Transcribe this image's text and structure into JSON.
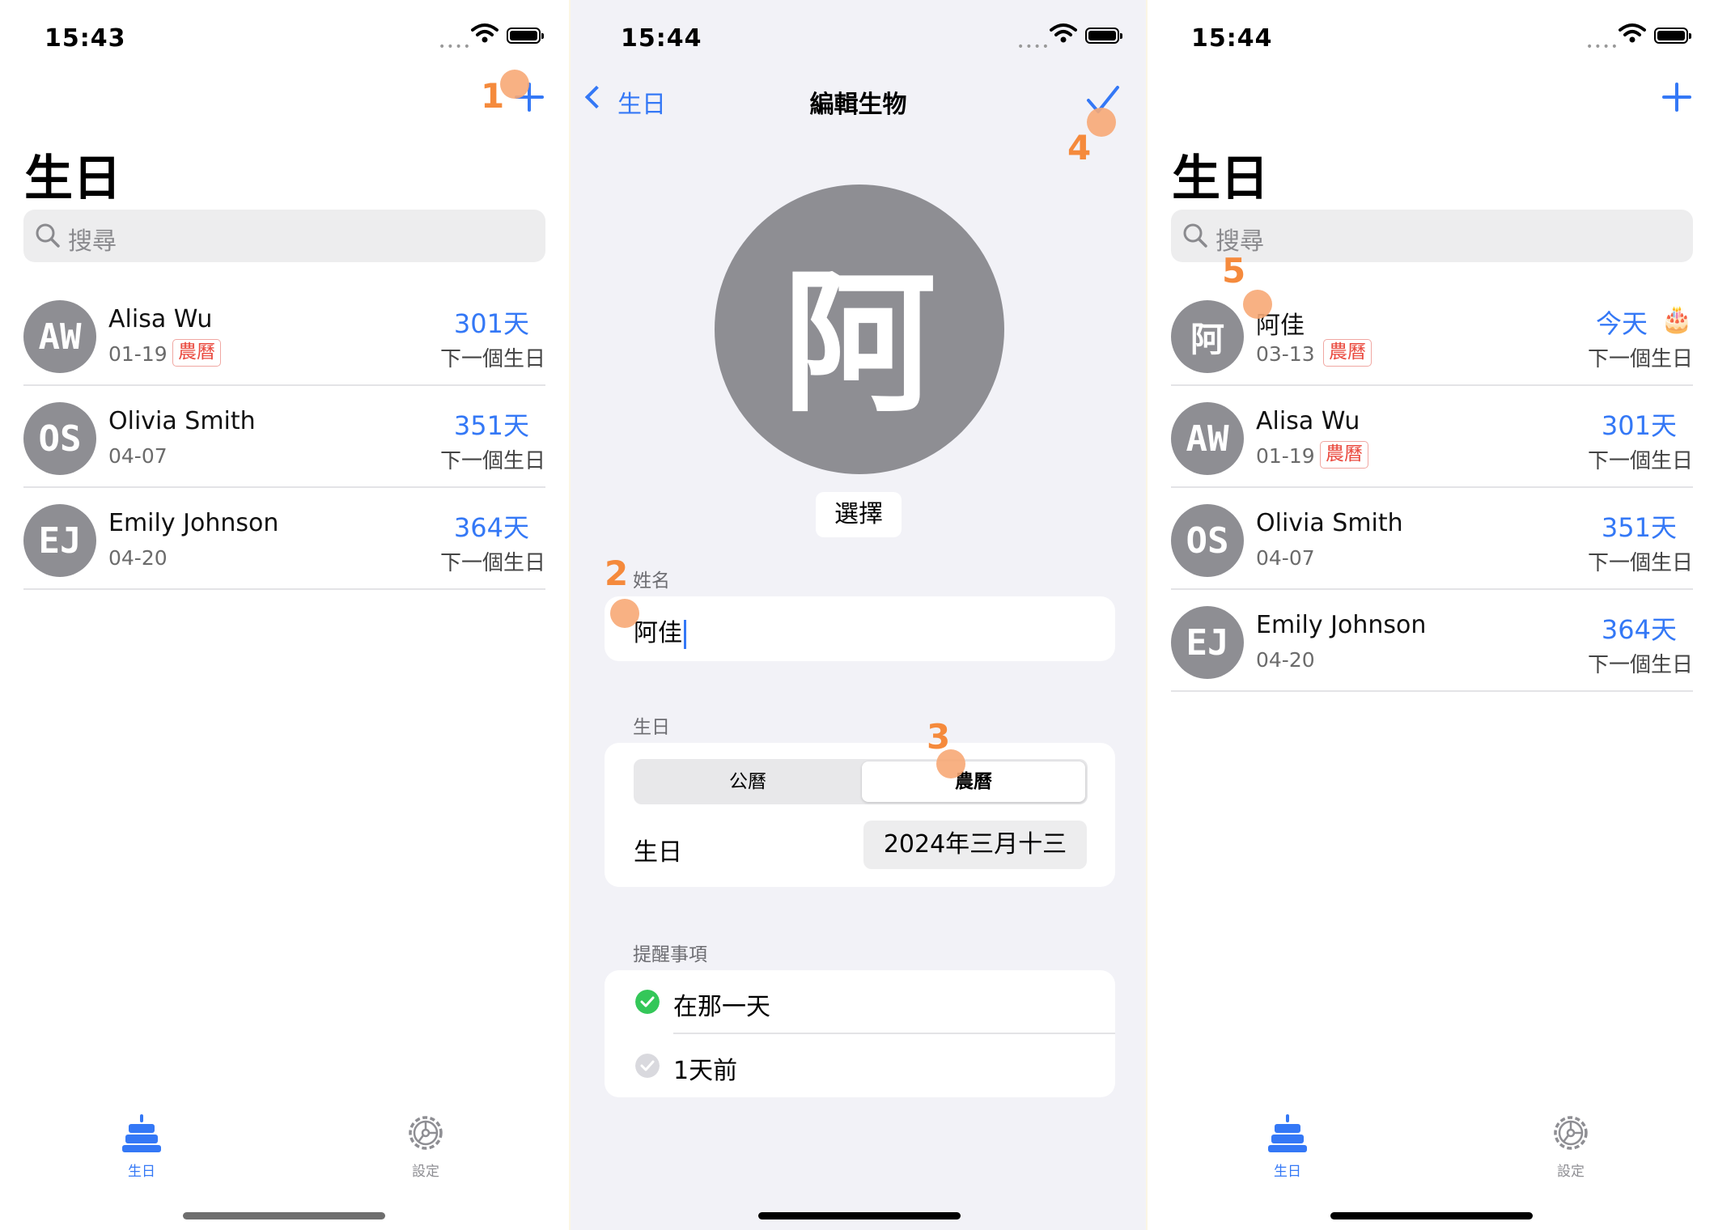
{
  "panel1": {
    "time": "15:43",
    "title": "生日",
    "search_placeholder": "搜尋",
    "step": "1",
    "rows": [
      {
        "initials": "AW",
        "name": "Alisa Wu",
        "date": "01-19",
        "tag": "農曆",
        "days": "301天",
        "next": "下一個生日"
      },
      {
        "initials": "OS",
        "name": "Olivia Smith",
        "date": "04-07",
        "tag": "",
        "days": "351天",
        "next": "下一個生日"
      },
      {
        "initials": "EJ",
        "name": "Emily Johnson",
        "date": "04-20",
        "tag": "",
        "days": "364天",
        "next": "下一個生日"
      }
    ],
    "tabs": {
      "birthday": "生日",
      "settings": "設定"
    }
  },
  "panel2": {
    "time": "15:44",
    "back_label": "生日",
    "nav_title": "編輯生物",
    "avatar_char": "阿",
    "choose_label": "選擇",
    "name_section": "姓名",
    "name_value": "阿佳",
    "birthday_section": "生日",
    "calendar_options": [
      "公曆",
      "農曆"
    ],
    "calendar_selected": "農曆",
    "birthday_field_label": "生日",
    "birthday_value": "2024年三月十三",
    "reminders_section": "提醒事項",
    "reminders": [
      {
        "label": "在那一天",
        "checked": true
      },
      {
        "label": "1天前",
        "checked": false
      }
    ],
    "steps": [
      "2",
      "3",
      "4"
    ]
  },
  "panel3": {
    "time": "15:44",
    "title": "生日",
    "search_placeholder": "搜尋",
    "step": "5",
    "rows": [
      {
        "initials": "阿",
        "name": "阿佳",
        "date": "03-13",
        "tag": "農曆",
        "days": "今天",
        "next": "下一個生日",
        "cake": "🎂"
      },
      {
        "initials": "AW",
        "name": "Alisa Wu",
        "date": "01-19",
        "tag": "農曆",
        "days": "301天",
        "next": "下一個生日"
      },
      {
        "initials": "OS",
        "name": "Olivia Smith",
        "date": "04-07",
        "tag": "",
        "days": "351天",
        "next": "下一個生日"
      },
      {
        "initials": "EJ",
        "name": "Emily Johnson",
        "date": "04-20",
        "tag": "",
        "days": "364天",
        "next": "下一個生日"
      }
    ],
    "tabs": {
      "birthday": "生日",
      "settings": "設定"
    }
  },
  "colors": {
    "accent": "#3478f6",
    "lunar_tag": "#ea4a3f",
    "avatar": "#8e8e93",
    "marker": "#f7a876",
    "step_number": "#f58a3c",
    "check_green": "#34c759"
  }
}
